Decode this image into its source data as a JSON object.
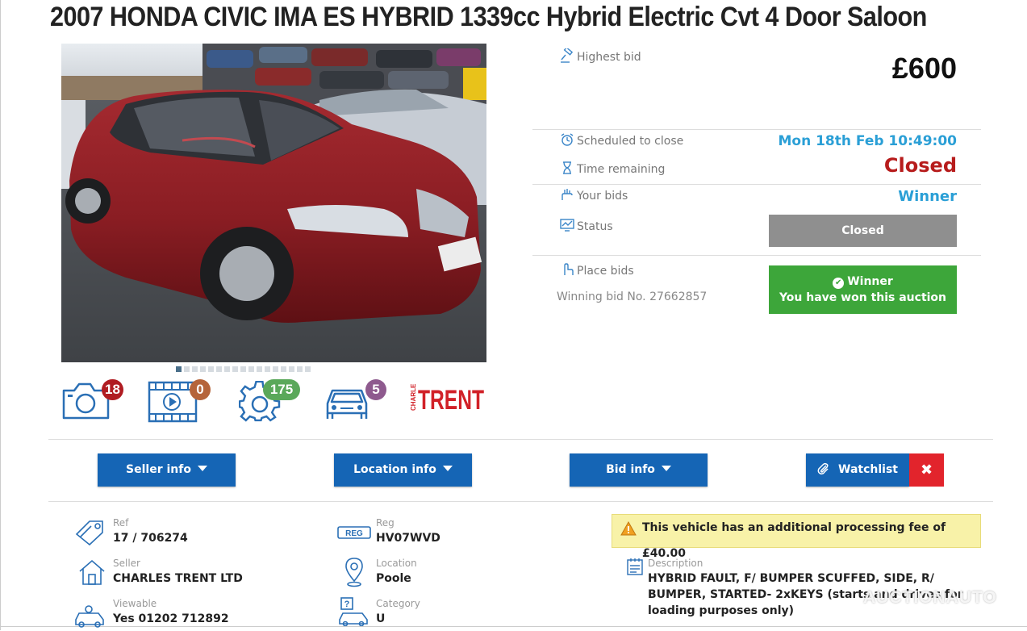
{
  "title": "2007 HONDA CIVIC IMA ES HYBRID 1339cc Hybrid Electric Cvt 4 Door Saloon",
  "gallery": {
    "dot_count": 17,
    "active_index": 0,
    "counts": {
      "photos": "18",
      "videos": "0",
      "features": "175",
      "vehicles": "5"
    },
    "badge_colors": {
      "photos": "#b01c22",
      "videos": "#b5643a",
      "features": "#5aa85a",
      "vehicles": "#8e5a8e"
    },
    "seller_logo_brand": "CHARLES",
    "seller_logo_name": "TRENT"
  },
  "auction": {
    "highest_bid_label": "Highest bid",
    "highest_bid": "£600",
    "scheduled_label": "Scheduled to close",
    "scheduled_value": "Mon 18th Feb 10:49:00",
    "time_remaining_label": "Time remaining",
    "time_remaining_value": "Closed",
    "your_bids_label": "Your bids",
    "your_bids_value": "Winner",
    "status_label": "Status",
    "status_value": "Closed",
    "place_bids_label": "Place bids",
    "winning_bid_text": "Winning bid No. 27662857",
    "winner_title": "Winner",
    "winner_subtitle": "You have won this auction",
    "colors": {
      "accent": "#2a9fd6",
      "closed": "#b71c1c",
      "winner": "#3da63a"
    }
  },
  "tabs": {
    "seller": "Seller info",
    "location": "Location info",
    "bid": "Bid info",
    "watchlist": "Watchlist",
    "remove": "✖"
  },
  "details": {
    "ref_label": "Ref",
    "ref_value": "17 / 706274",
    "seller_label": "Seller",
    "seller_value": "CHARLES TRENT LTD",
    "viewable_label": "Viewable",
    "viewable_value": "Yes 01202 712892",
    "reg_label": "Reg",
    "reg_value": "HV07WVD",
    "reg_icon_text": "REG",
    "location_label": "Location",
    "location_value": "Poole",
    "category_label": "Category",
    "category_value": "U",
    "fee_notice": "This vehicle has an additional processing fee of £40.00",
    "description_label": "Description",
    "description_value": "HYBRID FAULT, F/ BUMPER SCUFFED, SIDE, R/ BUMPER, STARTED- 2xKEYS (starts and drives for loading purposes only)"
  },
  "watermark": "AUCTIONAUTO"
}
